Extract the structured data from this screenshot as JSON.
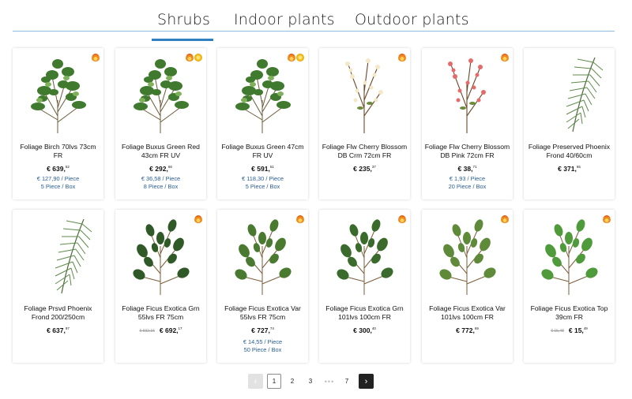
{
  "tabs": [
    {
      "label": "Shrubs",
      "active": true
    },
    {
      "label": "Indoor plants",
      "active": false
    },
    {
      "label": "Outdoor plants",
      "active": false
    }
  ],
  "colors": {
    "accent": "#2f7fc1",
    "link": "#2a5e96",
    "pager_active": "#222222"
  },
  "products": [
    {
      "name": "Foliage Birch 70lvs 73cm FR",
      "old_price": "",
      "price_main": "€ 639,",
      "price_cents": "52",
      "unit_price": "€ 127,90 / Piece",
      "per_box": "5 Piece / Box",
      "badges": [
        "fire-icon"
      ]
    },
    {
      "name": "Foliage Buxus Green Red 43cm FR UV",
      "old_price": "",
      "price_main": "€ 292,",
      "price_cents": "66",
      "unit_price": "€ 36,58 / Piece",
      "per_box": "8 Piece / Box",
      "badges": [
        "fire-icon",
        "sun-icon"
      ]
    },
    {
      "name": "Foliage Buxus Green 47cm FR UV",
      "old_price": "",
      "price_main": "€ 591,",
      "price_cents": "51",
      "unit_price": "€ 118,30 / Piece",
      "per_box": "5 Piece / Box",
      "badges": [
        "fire-icon",
        "sun-icon"
      ]
    },
    {
      "name": "Foliage Flw Cherry Blossom DB Crm 72cm FR",
      "old_price": "",
      "price_main": "€ 235,",
      "price_cents": "37",
      "unit_price": "",
      "per_box": "",
      "badges": [
        "fire-icon"
      ]
    },
    {
      "name": "Foliage Flw Cherry Blossom DB Pink 72cm FR",
      "old_price": "",
      "price_main": "€ 38,",
      "price_cents": "71",
      "unit_price": "€ 1,93 / Piece",
      "per_box": "20 Piece / Box",
      "badges": [
        "fire-icon"
      ]
    },
    {
      "name": "Foliage Preserved Phoenix Frond 40/60cm",
      "old_price": "",
      "price_main": "€ 371,",
      "price_cents": "65",
      "unit_price": "",
      "per_box": "",
      "badges": []
    },
    {
      "name": "Foliage Prsvd Phoenix Frond 200/250cm",
      "old_price": "",
      "price_main": "€ 637,",
      "price_cents": "97",
      "unit_price": "",
      "per_box": "",
      "badges": []
    },
    {
      "name": "Foliage Ficus Exotica Grn 55lvs FR 75cm",
      "old_price": "€ 692,16",
      "price_main": "€ 692,",
      "price_cents": "17",
      "unit_price": "",
      "per_box": "",
      "badges": [
        "fire-icon"
      ]
    },
    {
      "name": "Foliage Ficus Exotica Var 55lvs FR 75cm",
      "old_price": "",
      "price_main": "€ 727,",
      "price_cents": "74",
      "unit_price": "€ 14,55 / Piece",
      "per_box": "50 Piece / Box",
      "badges": [
        "fire-icon"
      ]
    },
    {
      "name": "Foliage Ficus Exotica Grn 101lvs 100cm FR",
      "old_price": "",
      "price_main": "€ 300,",
      "price_cents": "40",
      "unit_price": "",
      "per_box": "",
      "badges": [
        "fire-icon"
      ]
    },
    {
      "name": "Foliage Ficus Exotica Var 101lvs 100cm FR",
      "old_price": "",
      "price_main": "€ 772,",
      "price_cents": "69",
      "unit_price": "",
      "per_box": "",
      "badges": [
        "fire-icon"
      ]
    },
    {
      "name": "Foliage Ficus Exotica Top 39cm FR",
      "old_price": "€ 15,48",
      "price_main": "€ 15,",
      "price_cents": "49",
      "unit_price": "",
      "per_box": "",
      "badges": [
        "fire-icon"
      ]
    }
  ],
  "pagination": {
    "prev_icon": "chevron-left-icon",
    "next_icon": "chevron-right-icon",
    "pages": [
      "1",
      "2",
      "3",
      "7"
    ],
    "ellipsis": "•••",
    "current": "1"
  }
}
